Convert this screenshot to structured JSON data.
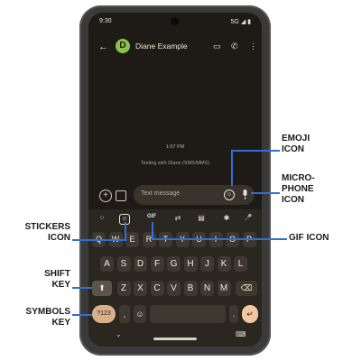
{
  "status": {
    "time": "9:30",
    "right": "5G ◢ ▮"
  },
  "header": {
    "back": "←",
    "avatar_letter": "D",
    "contact_name": "Diane Example",
    "video": "▭",
    "call": "✆",
    "more": "⋮"
  },
  "conversation": {
    "time": "1:07 PM",
    "texting_with": "Texting with Diane (SMS/MMS)"
  },
  "compose": {
    "placeholder": "Text message",
    "emoji": "☺"
  },
  "toolbar": {
    "apps": "⁘",
    "sticker": "☺",
    "gif": "GIF",
    "translate": "⇄",
    "clipboard": "▤",
    "settings": "✱",
    "mic": "🎤"
  },
  "keyboard": {
    "row1": [
      "Q",
      "W",
      "E",
      "R",
      "T",
      "Y",
      "U",
      "I",
      "O",
      "P"
    ],
    "row2": [
      "A",
      "S",
      "D",
      "F",
      "G",
      "H",
      "J",
      "K",
      "L"
    ],
    "row3": [
      "Z",
      "X",
      "C",
      "V",
      "B",
      "N",
      "M"
    ],
    "symbols": "?123",
    "comma": ",",
    "emoji": "☺",
    "period": ".",
    "shift": "⬆",
    "backspace": "⌫",
    "enter": "↵",
    "nav_chevron": "⌄",
    "nav_keyboard": "⌨"
  },
  "callouts": {
    "emoji": [
      "EMOJI",
      "ICON"
    ],
    "microphone": [
      "MICRO-",
      "PHONE",
      "ICON"
    ],
    "stickers": [
      "STICKERS",
      "ICON"
    ],
    "gif": "GIF ICON",
    "shift": [
      "SHIFT",
      "KEY"
    ],
    "symbols": [
      "SYMBOLS",
      "KEY"
    ]
  },
  "colors": {
    "callout_line": "#2f6fd6",
    "screen_bg": "#1e1b16",
    "keyboard_bg": "#2a2620",
    "avatar": "#8bc34a",
    "enter_key": "#f4c7a0"
  }
}
